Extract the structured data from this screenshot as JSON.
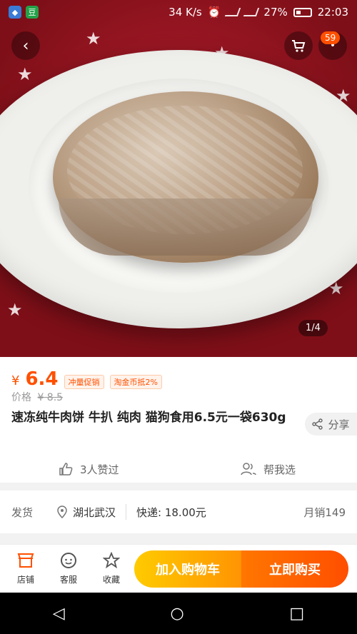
{
  "status_bar": {
    "network_speed": "34 K/s",
    "battery": "27%",
    "time": "22:03",
    "app_badge_2": "豆"
  },
  "hero": {
    "counter": "1/4",
    "cart_count": "59"
  },
  "product": {
    "currency": "¥",
    "price": "6.4",
    "tags": [
      "冲量促销",
      "淘金币抵2%"
    ],
    "original_label": "价格",
    "original_price": "¥ 8.5",
    "title": "速冻纯牛肉饼 牛扒 纯肉 猫狗食用6.5元一袋630g",
    "share_label": "分享",
    "likes_label": "3人赞过",
    "help_label": "帮我选"
  },
  "shipping": {
    "label": "发货",
    "location": "湖北武汉",
    "delivery": "快递: 18.00元",
    "monthly_sales": "月销149"
  },
  "bottom_bar": {
    "shop_label": "店铺",
    "service_label": "客服",
    "favorite_label": "收藏",
    "add_to_cart": "加入购物车",
    "buy_now": "立即购买"
  },
  "colors": {
    "accent": "#ff5000",
    "cart_start": "#ffcb00",
    "buy_end": "#ff4e00"
  },
  "icons": [
    "back-icon",
    "cart-icon",
    "more-icon",
    "share-icon",
    "thumbs-up-icon",
    "help-choose-icon",
    "location-icon",
    "shop-icon",
    "service-icon",
    "star-icon"
  ]
}
